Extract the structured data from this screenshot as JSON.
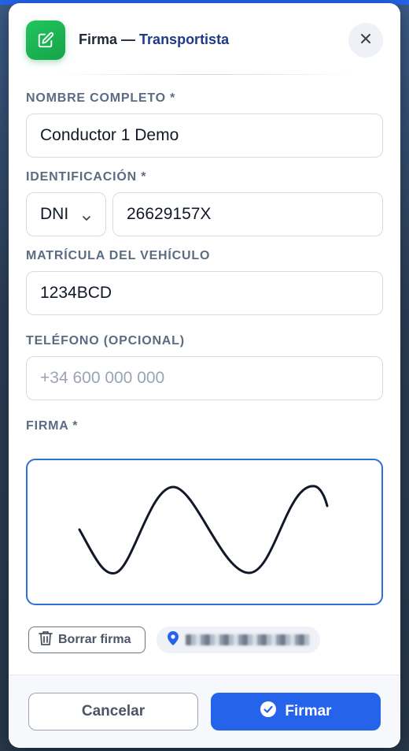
{
  "header": {
    "title_prefix": "Firma —",
    "title_role": "Transportista",
    "header_icon": "edit-square-icon",
    "close_icon": "close-icon",
    "accent_color": "#16a34a"
  },
  "form": {
    "full_name": {
      "label": "NOMBRE COMPLETO *",
      "value": "Conductor 1 Demo"
    },
    "identification": {
      "label": "IDENTIFICACIÓN *",
      "doc_type": "DNI",
      "value": "26629157X"
    },
    "plate": {
      "label": "MATRÍCULA DEL VEHÍCULO",
      "value": "1234BCD"
    },
    "phone": {
      "label": "TELÉFONO (OPCIONAL)",
      "value": "",
      "placeholder": "+34 600 000 000"
    },
    "signature": {
      "label": "FIRMA *",
      "border_color": "#2f6fd6"
    }
  },
  "actions": {
    "clear_signature": "Borrar firma",
    "clear_icon": "trash-icon",
    "location_icon": "map-pin-icon",
    "cancel": "Cancelar",
    "sign": "Firmar",
    "sign_icon": "check-circle-icon",
    "primary_color": "#2563eb"
  }
}
